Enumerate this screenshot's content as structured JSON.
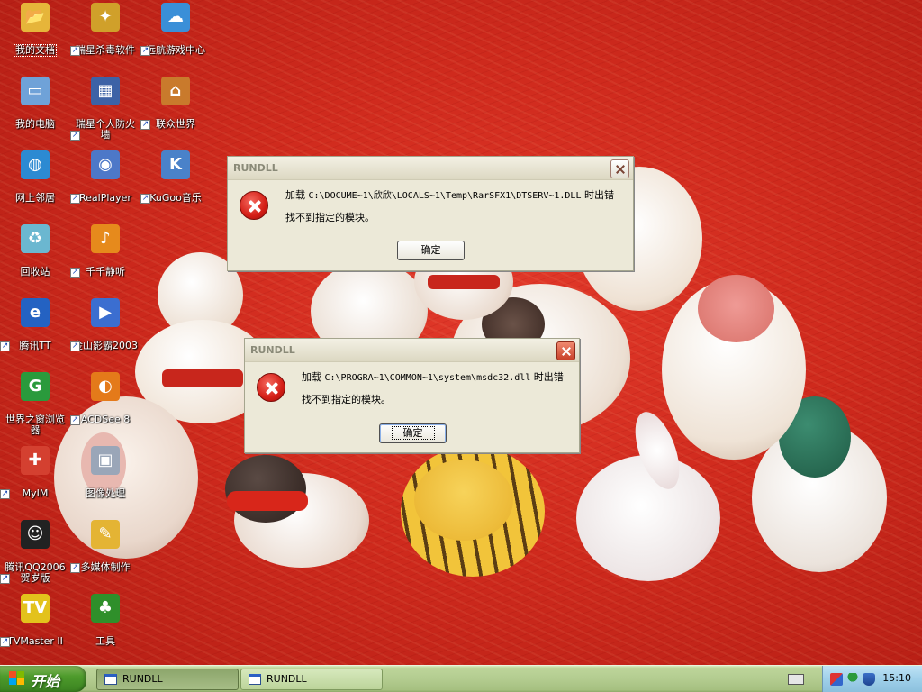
{
  "desktop": {
    "icons": [
      {
        "label": "我的文档",
        "symbol": "📂",
        "color": "#e6b53a"
      },
      {
        "label": "瑞星杀毒软件",
        "symbol": "✦",
        "color": "#d0a02a"
      },
      {
        "label": "远航游戏中心",
        "symbol": "☁",
        "color": "#3a8fd8"
      },
      {
        "label": "我的电脑",
        "symbol": "▭",
        "color": "#6fa2d8"
      },
      {
        "label": "瑞星个人防火墙",
        "symbol": "▦",
        "color": "#3d62a6"
      },
      {
        "label": "联众世界",
        "symbol": "⌂",
        "color": "#c97a2c"
      },
      {
        "label": "网上邻居",
        "symbol": "◍",
        "color": "#2c8ad2"
      },
      {
        "label": "RealPlayer",
        "symbol": "◉",
        "color": "#4d78c8"
      },
      {
        "label": "KuGoo音乐",
        "symbol": "K",
        "color": "#4a82c9"
      },
      {
        "label": "回收站",
        "symbol": "♻",
        "color": "#6bb7d0"
      },
      {
        "label": "千千静听",
        "symbol": "♪",
        "color": "#e68a1c"
      },
      {
        "label": "腾讯TT",
        "symbol": "e",
        "color": "#2462c2"
      },
      {
        "label": "金山影霸2003",
        "symbol": "▶",
        "color": "#3b6ed0"
      },
      {
        "label": "世界之窗浏览器",
        "symbol": "G",
        "color": "#2a9a3c"
      },
      {
        "label": "ACDSee 8",
        "symbol": "◐",
        "color": "#e47a1a"
      },
      {
        "label": "MyIM",
        "symbol": "✚",
        "color": "#d44030"
      },
      {
        "label": "图像处理",
        "symbol": "▣",
        "color": "#9aa6b8"
      },
      {
        "label": "腾讯QQ2006贺岁版",
        "symbol": "☺",
        "color": "#222222"
      },
      {
        "label": "多媒体制作",
        "symbol": "✎",
        "color": "#e4b434"
      },
      {
        "label": "TVMaster II",
        "symbol": "TV",
        "color": "#e3c21c"
      },
      {
        "label": "工具",
        "symbol": "♣",
        "color": "#2f8f2a"
      }
    ]
  },
  "dialogs": [
    {
      "title": "RUNDLL",
      "message_prefix": "加载 ",
      "message_path": "C:\\DOCUME~1\\欣欣\\LOCALS~1\\Temp\\RarSFX1\\DTSERV~1.DLL",
      "message_suffix": " 时出错",
      "message_line2": "找不到指定的模块。",
      "ok_label": "确定"
    },
    {
      "title": "RUNDLL",
      "message_prefix": "加载 ",
      "message_path": "C:\\PROGRA~1\\COMMON~1\\system\\msdc32.dll",
      "message_suffix": " 时出错",
      "message_line2": "找不到指定的模块。",
      "ok_label": "确定"
    }
  ],
  "taskbar": {
    "start_label": "开始",
    "tasks": [
      {
        "label": "RUNDLL",
        "pressed": true
      },
      {
        "label": "RUNDLL",
        "pressed": false
      }
    ],
    "clock": "15:10"
  },
  "colors": {
    "xp_green": "#4e9b2c",
    "error_red": "#d41e16",
    "dialog_face": "#ece9d8"
  }
}
